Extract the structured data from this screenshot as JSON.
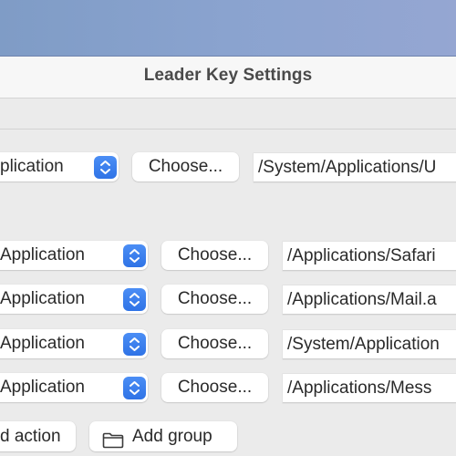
{
  "window": {
    "title": "Leader Key Settings"
  },
  "top_action": {
    "type_label": "plication",
    "choose_label": "Choose...",
    "path": "/System/Applications/U",
    "stepper_icon": "up-down-chevron-icon"
  },
  "group_actions": [
    {
      "type_label": "Application",
      "choose_label": "Choose...",
      "path": "/Applications/Safari"
    },
    {
      "type_label": "Application",
      "choose_label": "Choose...",
      "path": "/Applications/Mail.a"
    },
    {
      "type_label": "Application",
      "choose_label": "Choose...",
      "path": "/System/Application"
    },
    {
      "type_label": "Application",
      "choose_label": "Choose...",
      "path": "/Applications/Mess"
    }
  ],
  "footer": {
    "add_action_label": "d action",
    "add_group_label": "Add group",
    "add_group_icon": "folder-icon"
  },
  "colors": {
    "accent": "#3b7ff0",
    "window_bg": "#ebebeb",
    "titlebar_bg": "#f7f7f7"
  }
}
